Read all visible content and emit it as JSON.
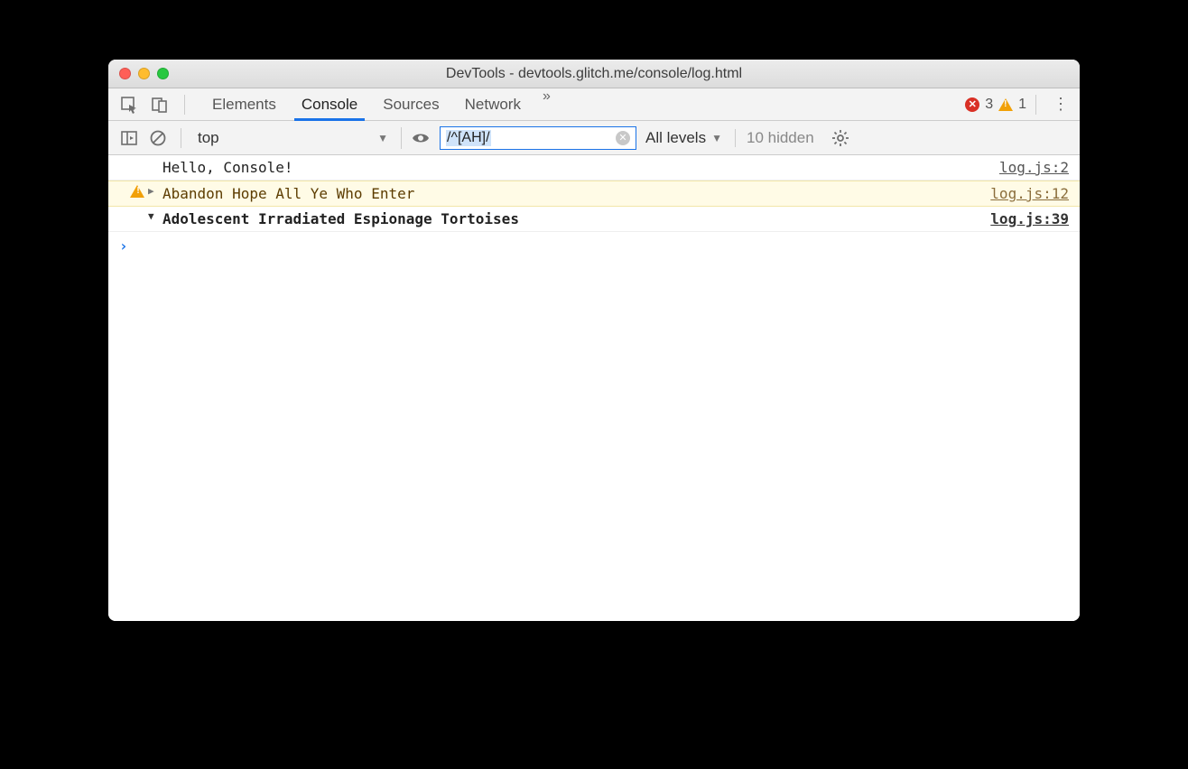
{
  "window": {
    "title": "DevTools - devtools.glitch.me/console/log.html"
  },
  "tabs": {
    "items": [
      "Elements",
      "Console",
      "Sources",
      "Network"
    ],
    "active_index": 1,
    "overflow_glyph": "»"
  },
  "status": {
    "error_count": "3",
    "warning_count": "1"
  },
  "filterbar": {
    "context": "top",
    "filter_value": "/^[AH]/",
    "levels_label": "All levels",
    "hidden_label": "10 hidden"
  },
  "messages": [
    {
      "type": "log",
      "expandable": false,
      "expanded": false,
      "text": "Hello, Console!",
      "source": "log.js:2"
    },
    {
      "type": "warning",
      "expandable": true,
      "expanded": false,
      "text": "Abandon Hope All Ye Who Enter",
      "source": "log.js:12"
    },
    {
      "type": "info",
      "expandable": true,
      "expanded": true,
      "text": "Adolescent Irradiated Espionage Tortoises",
      "source": "log.js:39"
    }
  ],
  "prompt_glyph": "›"
}
